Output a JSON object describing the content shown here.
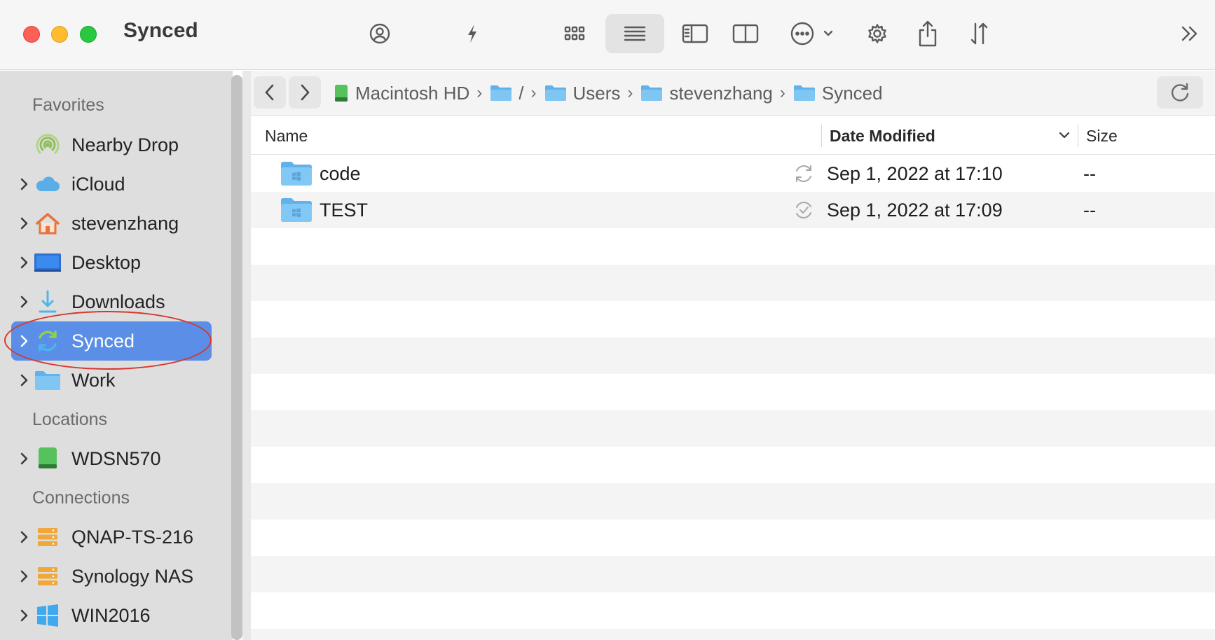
{
  "window": {
    "title": "Synced"
  },
  "toolbar": {
    "buttons": [
      {
        "icon": "person-circle-icon"
      },
      {
        "icon": "bolt-icon"
      },
      {
        "icon": "grid-view-icon"
      },
      {
        "icon": "list-view-icon",
        "active": true
      },
      {
        "icon": "sidebar-icon"
      },
      {
        "icon": "split-pane-icon"
      },
      {
        "icon": "more-options-icon"
      },
      {
        "icon": "gear-icon"
      },
      {
        "icon": "share-icon"
      },
      {
        "icon": "sort-icon"
      },
      {
        "icon": "overflow-chevrons-icon"
      }
    ]
  },
  "sidebar": {
    "sections": {
      "favorites": "Favorites",
      "locations": "Locations",
      "connections": "Connections"
    },
    "items": [
      {
        "label": "Nearby Drop",
        "icon": "nearby-drop-icon"
      },
      {
        "label": "iCloud",
        "icon": "cloud-icon"
      },
      {
        "label": "stevenzhang",
        "icon": "home-icon"
      },
      {
        "label": "Desktop",
        "icon": "desktop-icon"
      },
      {
        "label": "Downloads",
        "icon": "download-icon"
      },
      {
        "label": "Synced",
        "icon": "sync-icon",
        "selected": true
      },
      {
        "label": "Work",
        "icon": "folder-icon"
      },
      {
        "label": "WDSN570",
        "icon": "drive-icon"
      },
      {
        "label": "QNAP-TS-216",
        "icon": "server-icon"
      },
      {
        "label": "Synology NAS",
        "icon": "server-icon"
      },
      {
        "label": "WIN2016",
        "icon": "windows-icon"
      }
    ]
  },
  "pathbar": {
    "crumbs": [
      {
        "label": "Macintosh HD",
        "icon": "drive-icon"
      },
      {
        "label": "/",
        "icon": "folder-icon"
      },
      {
        "label": "Users",
        "icon": "folder-icon"
      },
      {
        "label": "stevenzhang",
        "icon": "folder-icon"
      },
      {
        "label": "Synced",
        "icon": "folder-icon"
      }
    ]
  },
  "list": {
    "columns": {
      "name": "Name",
      "date": "Date Modified",
      "size": "Size"
    },
    "rows": [
      {
        "name": "code",
        "date": "Sep 1, 2022 at 17:10",
        "size": "--",
        "status_icon": "syncing-icon"
      },
      {
        "name": "TEST",
        "date": "Sep 1, 2022 at 17:09",
        "size": "--",
        "status_icon": "synced-check-icon"
      }
    ]
  },
  "colors": {
    "selection": "#5b8ee6",
    "annotation_ring": "#d9362b",
    "folder": "#6cbcf0"
  }
}
